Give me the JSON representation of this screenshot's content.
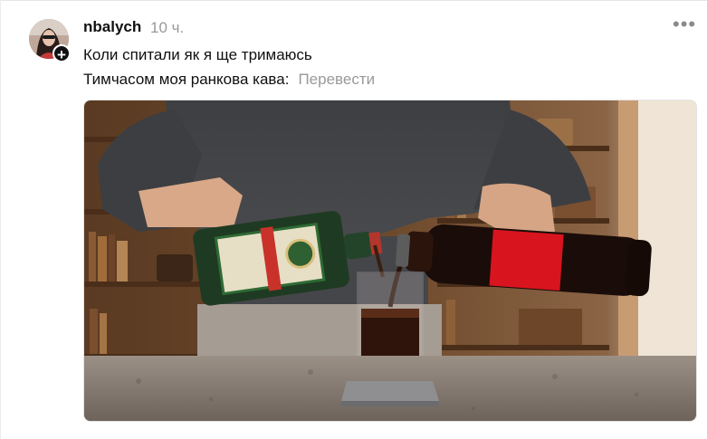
{
  "post": {
    "author": "nbalych",
    "time": "10 ч.",
    "more_icon": "more-horizontal-icon",
    "follow_icon": "plus-icon",
    "text_line1": "Коли спитали як я ще тримаюсь",
    "text_line2": "Тимчасом моя ранкова кава:",
    "translate_label": "Перевести"
  },
  "media": {
    "bottle_left_label": "Jägermeister",
    "bottle_right_label": "Coca-Cola zero"
  },
  "colors": {
    "text": "#101010",
    "muted": "#999999",
    "coke_red": "#d8141e",
    "jager_green": "#1f3a22",
    "wood": "#7a4a27"
  }
}
